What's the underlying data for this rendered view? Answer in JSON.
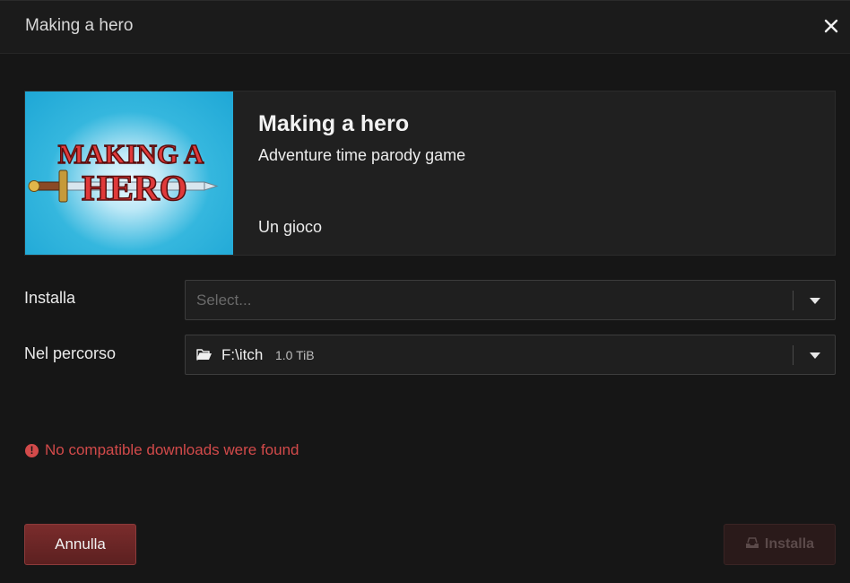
{
  "dialog": {
    "title": "Making a hero"
  },
  "game": {
    "title": "Making a hero",
    "subtitle": "Adventure time parody game",
    "type": "Un gioco",
    "cover_logo_line1": "MAKING A",
    "cover_logo_line2": "HERO"
  },
  "form": {
    "install_label": "Installa",
    "install_placeholder": "Select...",
    "location_label": "Nel percorso",
    "location_path": "F:\\itch",
    "location_size": "1.0 TiB"
  },
  "error": {
    "message": "No compatible downloads were found",
    "icon": "!"
  },
  "buttons": {
    "cancel_label": "Annulla",
    "install_label": "Installa"
  },
  "colors": {
    "accent": "#7a2c2c",
    "error": "#d24a4a",
    "background": "#161616"
  },
  "icons": {
    "close": "close-icon",
    "folder": "folder-open-icon",
    "install": "inbox-download-icon",
    "error": "exclamation-circle-icon",
    "dropdown": "chevron-down-icon"
  }
}
